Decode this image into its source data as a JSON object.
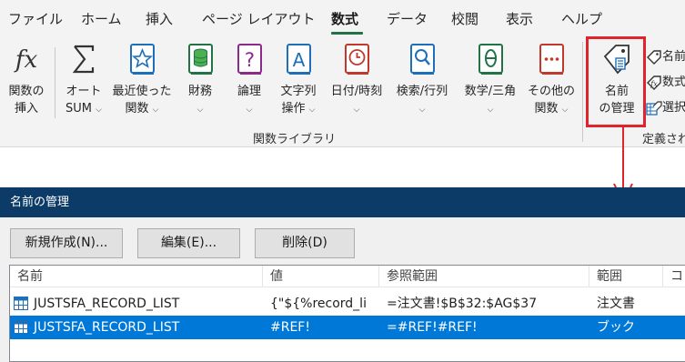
{
  "ribbon": {
    "tabs": [
      "ファイル",
      "ホーム",
      "挿入",
      "ページ レイアウト",
      "数式",
      "データ",
      "校閲",
      "表示",
      "ヘルプ"
    ],
    "active_tab": "数式",
    "buttons": {
      "insert_function": [
        "関数の",
        "挿入"
      ],
      "autosum": [
        "オート",
        "SUM"
      ],
      "recent": [
        "最近使った",
        "関数"
      ],
      "financial": [
        "財務"
      ],
      "logical": [
        "論理"
      ],
      "text": [
        "文字列",
        "操作"
      ],
      "datetime": [
        "日付/時刻"
      ],
      "lookup": [
        "検索/行列"
      ],
      "math": [
        "数学/三角"
      ],
      "more": [
        "その他の",
        "関数"
      ],
      "name_manager": [
        "名前",
        "の管理"
      ]
    },
    "group_library_label": "関数ライブラリ",
    "group_defined_label": "定義され",
    "defined_names_items": [
      "名前",
      "数式",
      "選択"
    ],
    "accent": "#217346",
    "highlight_color": "#e0242d"
  },
  "dialog": {
    "title": "名前の管理",
    "title_bg": "#0b3b66",
    "buttons": {
      "new": "新規作成(N)...",
      "edit": "編集(E)...",
      "delete": "削除(D)"
    },
    "columns": [
      "名前",
      "値",
      "参照範囲",
      "範囲",
      "コ"
    ],
    "rows": [
      {
        "name": "JUSTSFA_RECORD_LIST",
        "value": "{\"${%record_li",
        "refers_to": "=注文書!$B$32:$AG$37",
        "scope": "注文書",
        "selected": false
      },
      {
        "name": "JUSTSFA_RECORD_LIST",
        "value": "#REF!",
        "refers_to": "=#REF!#REF!",
        "scope": "ブック",
        "selected": true
      }
    ],
    "selection_color": "#0078d7"
  }
}
